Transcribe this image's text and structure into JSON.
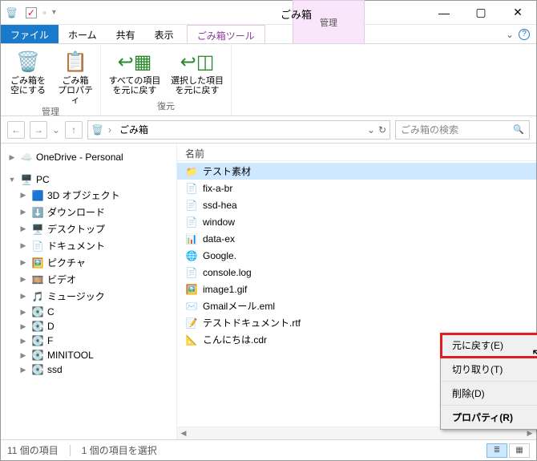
{
  "titlebar": {
    "context_tab_top": "管理",
    "context_tab_bottom": "ごみ箱ツール",
    "title": "ごみ箱"
  },
  "win": {
    "min": "—",
    "max": "▢",
    "close": "✕"
  },
  "tabs": {
    "file": "ファイル",
    "home": "ホーム",
    "share": "共有",
    "view": "表示",
    "tool": "ごみ箱ツール",
    "help_caret": "⌄",
    "help_icon": "?"
  },
  "ribbon": {
    "manage": {
      "label": "管理",
      "empty": "ごみ箱を\n空にする",
      "props": "ごみ箱\nプロパティ"
    },
    "restore": {
      "label": "復元",
      "all": "すべての項目\nを元に戻す",
      "sel": "選択した項目\nを元に戻す"
    }
  },
  "nav": {
    "back": "←",
    "fwd": "→",
    "drop": "⌄",
    "up": "↑",
    "crumb1": "ごみ箱",
    "refresh": "↻",
    "addr_drop": "⌄",
    "search_placeholder": "ごみ箱の検索",
    "search_icon": "🔍"
  },
  "tree": {
    "onedrive": "OneDrive - Personal",
    "pc": "PC",
    "pc_children": [
      {
        "icon": "🟦",
        "label": "3D オブジェクト"
      },
      {
        "icon": "⬇️",
        "label": "ダウンロード"
      },
      {
        "icon": "🖥️",
        "label": "デスクトップ"
      },
      {
        "icon": "📄",
        "label": "ドキュメント"
      },
      {
        "icon": "🖼️",
        "label": "ピクチャ"
      },
      {
        "icon": "🎞️",
        "label": "ビデオ"
      },
      {
        "icon": "🎵",
        "label": "ミュージック"
      },
      {
        "icon": "💽",
        "label": "C"
      },
      {
        "icon": "💽",
        "label": "D"
      },
      {
        "icon": "💽",
        "label": "F"
      },
      {
        "icon": "💽",
        "label": "MINITOOL"
      },
      {
        "icon": "💽",
        "label": "ssd"
      }
    ]
  },
  "list": {
    "col_name": "名前",
    "items": [
      {
        "icon": "📁",
        "name": "テスト素材",
        "sel": true
      },
      {
        "icon": "📄",
        "name": "fix-a-br"
      },
      {
        "icon": "📄",
        "name": "ssd-hea"
      },
      {
        "icon": "📄",
        "name": "window"
      },
      {
        "icon": "📊",
        "name": "data-ex"
      },
      {
        "icon": "🌐",
        "name": "Google."
      },
      {
        "icon": "📄",
        "name": "console.log"
      },
      {
        "icon": "🖼️",
        "name": "image1.gif"
      },
      {
        "icon": "✉️",
        "name": "Gmailメール.eml"
      },
      {
        "icon": "📝",
        "name": "テストドキュメント.rtf"
      },
      {
        "icon": "📐",
        "name": "こんにちは.cdr"
      }
    ]
  },
  "ctxmenu": {
    "restore": "元に戻す(E)",
    "cut": "切り取り(T)",
    "delete": "削除(D)",
    "props": "プロパティ(R)"
  },
  "status": {
    "count": "11 個の項目",
    "sel": "1 個の項目を選択"
  }
}
